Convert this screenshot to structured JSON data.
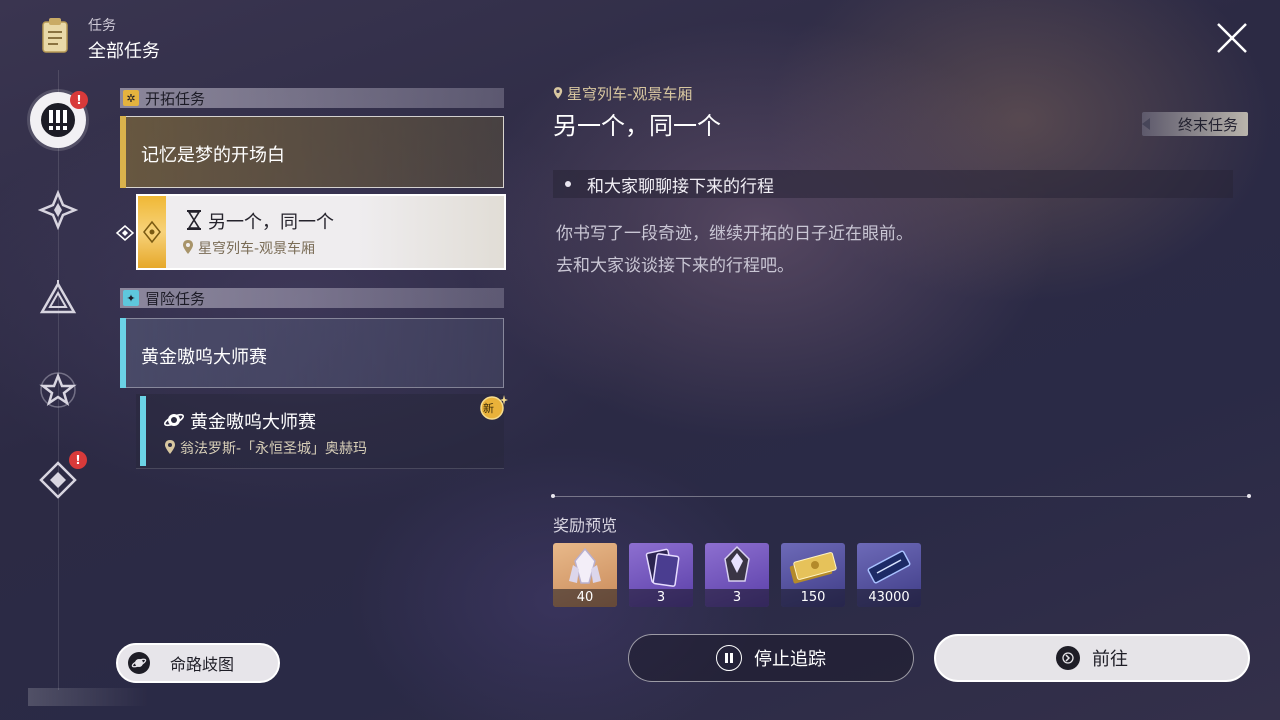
{
  "header": {
    "subtitle": "任务",
    "title": "全部任务"
  },
  "rail": [
    {
      "name": "all-quests",
      "active": true,
      "alert": "!"
    },
    {
      "name": "trailblaze",
      "active": false
    },
    {
      "name": "companion",
      "active": false
    },
    {
      "name": "adventure",
      "active": false
    },
    {
      "name": "daily",
      "active": false,
      "alert": "!"
    }
  ],
  "sections": {
    "trailblaze": {
      "label": "开拓任务"
    },
    "adventure": {
      "label": "冒险任务"
    }
  },
  "quests": {
    "memory": {
      "title": "记忆是梦的开场白"
    },
    "selected": {
      "title": "另一个，同一个",
      "location": "星穹列车-观景车厢"
    },
    "golden_group": {
      "title": "黄金嗷呜大师赛"
    },
    "golden_sub": {
      "title": "黄金嗷呜大师赛",
      "location": "翁法罗斯-「永恒圣城」奥赫玛",
      "badge": "新"
    }
  },
  "detail": {
    "location": "星穹列车-观景车厢",
    "title": "另一个，同一个",
    "type_tag": "终末任务",
    "objective": "和大家聊聊接下来的行程",
    "desc_line1": "你书写了一段奇迹，继续开拓的日子近在眼前。",
    "desc_line2": "去和大家谈谈接下来的行程吧。"
  },
  "rewards": {
    "label": "奖励预览",
    "items": [
      {
        "icon": "stellar-jade-icon",
        "count": "40"
      },
      {
        "icon": "character-exp-material-icon",
        "count": "3"
      },
      {
        "icon": "refine-aether-icon",
        "count": "3"
      },
      {
        "icon": "credits-icon",
        "count": "150"
      },
      {
        "icon": "trailblaze-exp-icon",
        "count": "43000"
      }
    ]
  },
  "buttons": {
    "stop_tracking": "停止追踪",
    "go": "前往",
    "path": "命路歧图"
  },
  "colors": {
    "trailblaze_accent": "#d9b24c",
    "adventure_accent": "#6bd3e6",
    "alert": "#d83a3a"
  }
}
